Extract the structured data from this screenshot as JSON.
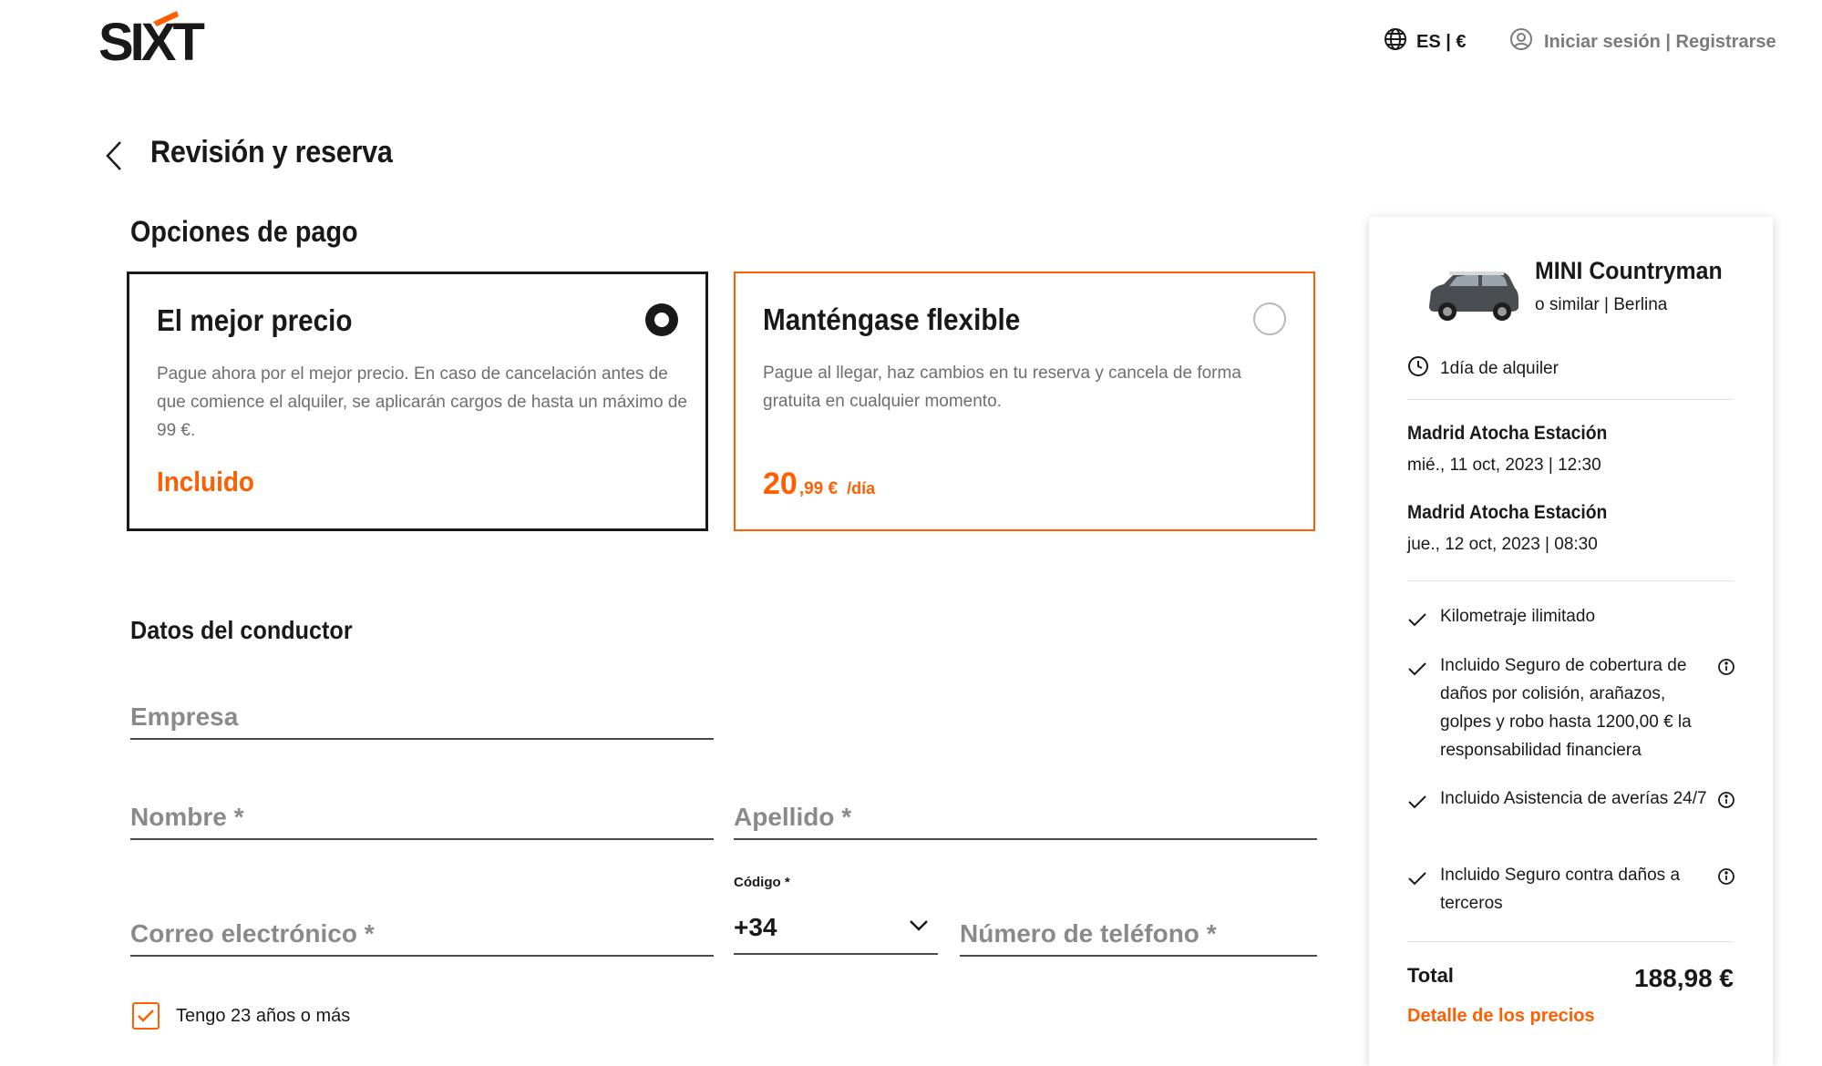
{
  "header": {
    "brand": "SIXT",
    "language_currency": "ES | €",
    "login_label": "Iniciar sesión | Registrarse"
  },
  "page": {
    "title": "Revisión y reserva"
  },
  "payment": {
    "title": "Opciones de pago",
    "options": [
      {
        "title": "El mejor precio",
        "description": "Pague ahora por el mejor precio. En caso de cancelación antes de que comience el alquiler, se aplicarán cargos de hasta un máximo de 99 €.",
        "price_label": "Incluido",
        "selected": true
      },
      {
        "title": "Manténgase flexible",
        "description": "Pague al llegar, haz cambios en tu reserva y cancela de forma gratuita en cualquier momento.",
        "price_int": "20",
        "price_dec": ",99 €",
        "price_per": "/día",
        "selected": false
      }
    ]
  },
  "driver": {
    "title": "Datos del conductor",
    "company_placeholder": "Empresa",
    "first_name_placeholder": "Nombre *",
    "last_name_placeholder": "Apellido *",
    "email_placeholder": "Correo electrónico *",
    "code_label": "Código *",
    "code_value": "+34",
    "phone_placeholder": "Número de teléfono *",
    "age_checkbox_label": "Tengo 23 años o más",
    "age_checked": true
  },
  "summary": {
    "car_name": "MINI Countryman",
    "car_sub": "o similar | Berlina",
    "rental_days": "1día de alquiler",
    "pickup": {
      "location": "Madrid Atocha Estación",
      "datetime": "mié., 11 oct, 2023 | 12:30"
    },
    "return": {
      "location": "Madrid Atocha Estación",
      "datetime": "jue., 12 oct, 2023 | 08:30"
    },
    "features": [
      {
        "text": "Kilometraje ilimitado",
        "info": false
      },
      {
        "text": "Incluido Seguro de cobertura de daños por colisión, arañazos, golpes y robo hasta 1200,00 € la responsabilidad financiera",
        "info": true
      },
      {
        "text": "Incluido Asistencia de averías 24/7",
        "info": true
      },
      {
        "text": "Incluido Seguro contra daños a terceros",
        "info": true
      }
    ],
    "total_label": "Total",
    "total_value": "188,98 €",
    "price_detail_link": "Detalle de los precios"
  },
  "colors": {
    "accent": "#ff5f00",
    "text": "#191919",
    "muted": "#7b7b7b"
  }
}
